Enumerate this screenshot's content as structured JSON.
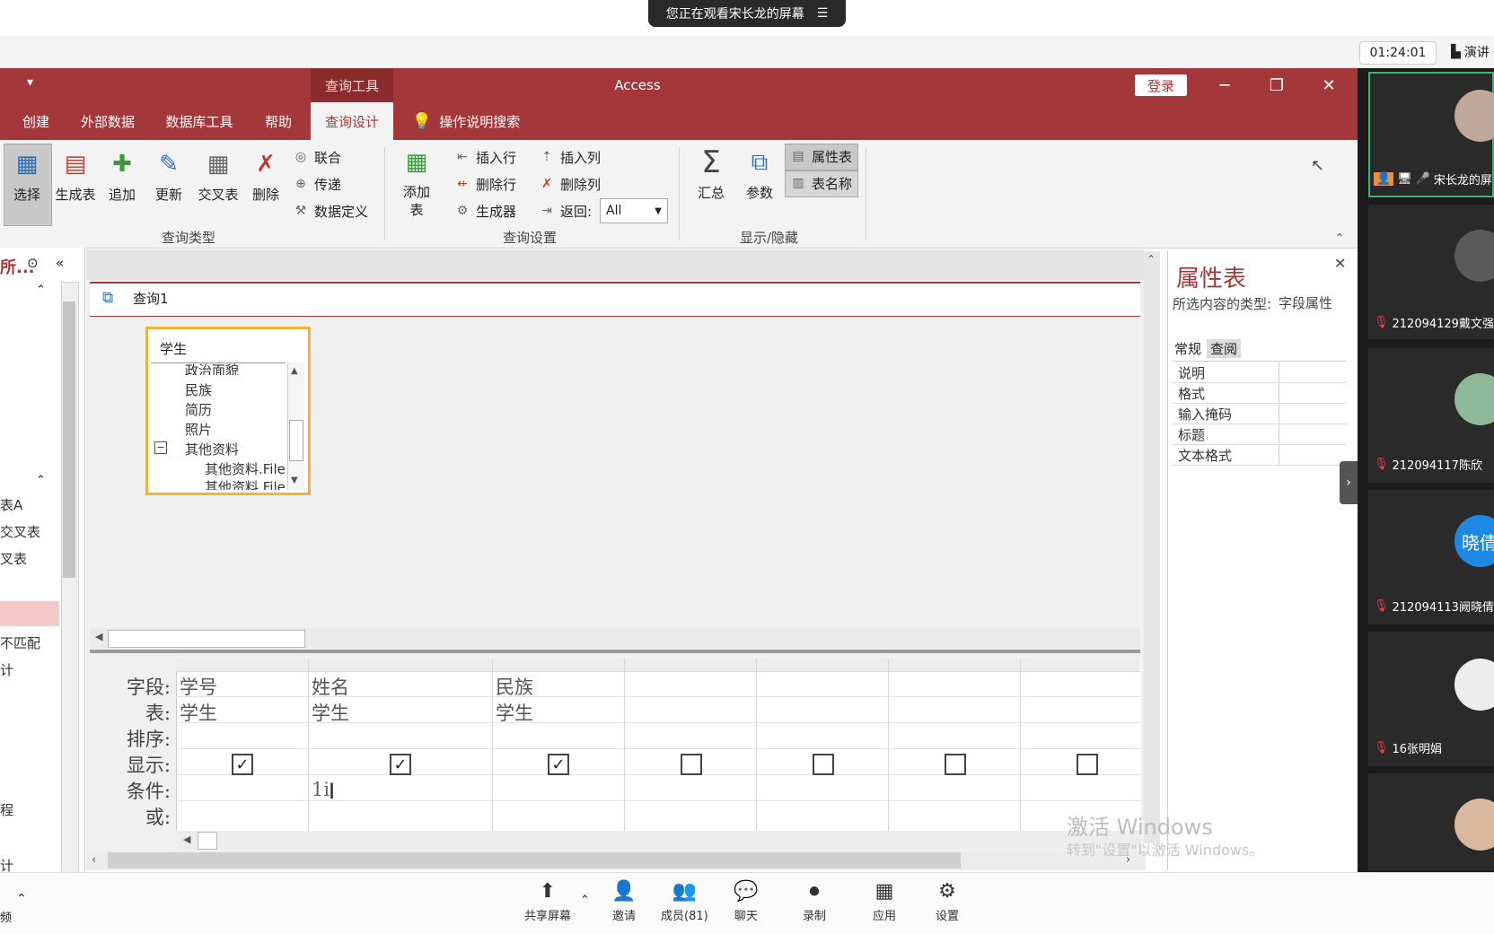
{
  "meeting": {
    "share_banner": "您正在观看宋长龙的屏幕",
    "clock": "01:24:01",
    "present_label": "演讲"
  },
  "app": {
    "context_tab": "查询工具",
    "title": "Access",
    "login": "登录",
    "tabs": [
      "创建",
      "外部数据",
      "数据库工具",
      "帮助",
      "查询设计"
    ],
    "search_hint": "操作说明搜索"
  },
  "ribbon": {
    "query_type": {
      "label": "查询类型",
      "buttons": [
        "选择",
        "生成表",
        "追加",
        "更新",
        "交叉表",
        "删除"
      ],
      "small": [
        "联合",
        "传递",
        "数据定义"
      ]
    },
    "query_setup": {
      "label": "查询设置",
      "add_table": "添加表",
      "small_left": [
        "插入行",
        "删除行",
        "生成器"
      ],
      "small_right": [
        "插入列",
        "删除列"
      ],
      "return_label": "返回:",
      "return_value": "All"
    },
    "show_hide": {
      "label": "显示/隐藏",
      "totals": "汇总",
      "params": "参数",
      "property_sheet": "属性表",
      "table_names": "表名称"
    }
  },
  "nav": {
    "header": "所...",
    "items": [
      "表A",
      "交叉表",
      "叉表",
      "不匹配",
      "计",
      "程",
      "计"
    ],
    "bottom": "频"
  },
  "designer": {
    "tab_label": "查询1",
    "table": {
      "title": "学生",
      "fields": [
        "政治面貌",
        "民族",
        "简历",
        "照片",
        "其他资料",
        "其他资料.File",
        "其他资料.File"
      ]
    },
    "row_labels": [
      "字段:",
      "表:",
      "排序:",
      "显示:",
      "条件:",
      "或:"
    ],
    "columns": [
      {
        "field": "学号",
        "table": "学生",
        "show": true,
        "criteria": ""
      },
      {
        "field": "姓名",
        "table": "学生",
        "show": true,
        "criteria": "1i"
      },
      {
        "field": "民族",
        "table": "学生",
        "show": true,
        "criteria": ""
      },
      {
        "field": "",
        "table": "",
        "show": false,
        "criteria": ""
      },
      {
        "field": "",
        "table": "",
        "show": false,
        "criteria": ""
      },
      {
        "field": "",
        "table": "",
        "show": false,
        "criteria": ""
      },
      {
        "field": "",
        "table": "",
        "show": false,
        "criteria": ""
      }
    ]
  },
  "property_sheet": {
    "title": "属性表",
    "type_label": "所选内容的类型:",
    "type_value": "字段属性",
    "tabs": [
      "常规",
      "查阅"
    ],
    "rows": [
      "说明",
      "格式",
      "输入掩码",
      "标题",
      "文本格式"
    ]
  },
  "participants": [
    {
      "name": "宋长龙的屏"
    },
    {
      "name": "212094129戴文强"
    },
    {
      "name": "212094117陈欣"
    },
    {
      "name": "212094113阙晓倩",
      "avatar_text": "晓倩"
    },
    {
      "name": "16张明娟"
    }
  ],
  "watermark": {
    "line1": "激活 Windows",
    "line2": "转到\"设置\"以激活 Windows。"
  },
  "toolbar": [
    "共享屏幕",
    "邀请",
    "成员(81)",
    "聊天",
    "录制",
    "应用",
    "设置"
  ]
}
